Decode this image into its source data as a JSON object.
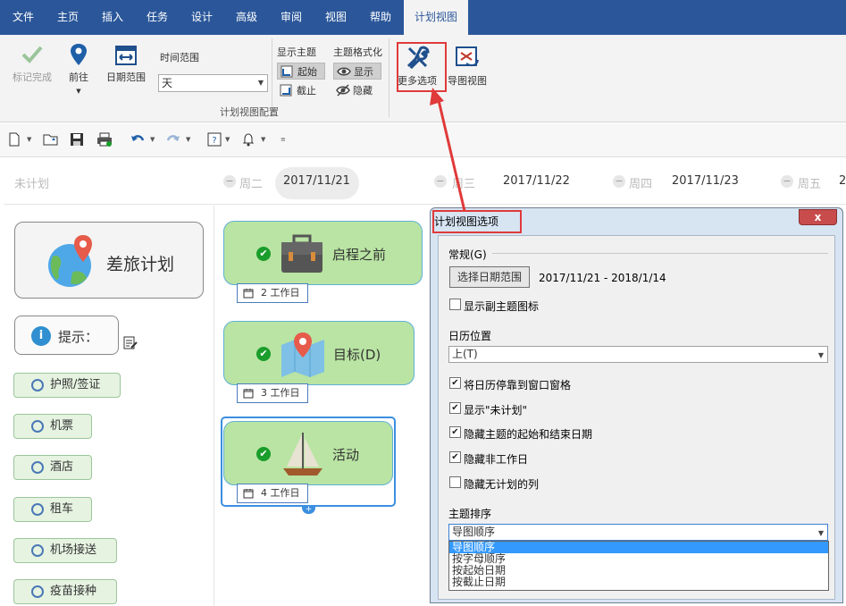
{
  "menu": {
    "tabs": [
      "文件",
      "主页",
      "插入",
      "任务",
      "设计",
      "高级",
      "审阅",
      "视图",
      "帮助",
      "计划视图"
    ],
    "active_tab": "计划视图"
  },
  "ribbon": {
    "mark_done": "标记完成",
    "go_to": "前往",
    "date_range": "日期范围",
    "time_range_label": "时间范围",
    "time_range_value": "天",
    "show_topic_label": "显示主题",
    "start_label": "起始",
    "end_label": "截止",
    "topic_format_label": "主题格式化",
    "show_label": "显示",
    "hide_label": "隐藏",
    "group_label": "计划视图配置",
    "more_options": "更多选项",
    "mindmap_view": "导图视图"
  },
  "timeline": {
    "unplanned": "未计划",
    "days": [
      {
        "weekday": "周二",
        "date": "2017/11/21"
      },
      {
        "weekday": "周三",
        "date": "2017/11/22"
      },
      {
        "weekday": "周四",
        "date": "2017/11/23"
      },
      {
        "weekday": "周五",
        "date": "2"
      }
    ]
  },
  "left": {
    "main_title": "差旅计划",
    "tip_label": "提示：",
    "items": [
      "护照/签证",
      "机票",
      "酒店",
      "租车",
      "机场接送",
      "疫苗接种"
    ]
  },
  "tasks": [
    {
      "name": "启程之前",
      "workdays": "2 工作日"
    },
    {
      "name": "目标(D)",
      "workdays": "3 工作日"
    },
    {
      "name": "活动",
      "workdays": "4 工作日"
    }
  ],
  "dialog": {
    "title": "计划视图选项",
    "close": "x",
    "general_label": "常规(G)",
    "select_date_range_btn": "选择日期范围",
    "date_range_value": "2017/11/21 - 2018/1/14",
    "show_sub_topic_icon": "显示副主题图标",
    "calendar_position_label": "日历位置",
    "calendar_position_value": "上(T)",
    "options": [
      {
        "label": "将日历停靠到窗口窗格",
        "checked": true
      },
      {
        "label": "显示\"未计划\"",
        "checked": true
      },
      {
        "label": "隐藏主题的起始和结束日期",
        "checked": true
      },
      {
        "label": "隐藏非工作日",
        "checked": true
      },
      {
        "label": "隐藏无计划的列",
        "checked": false
      }
    ],
    "sort_label": "主题排序",
    "sort_value": "导图顺序",
    "sort_options": [
      "导图顺序",
      "按字母顺序",
      "按起始日期",
      "按截止日期"
    ]
  },
  "colors": {
    "menu_bg": "#2b579a",
    "task_green": "#b9e4a3",
    "highlight_red": "#e03a3a",
    "check_green": "#1a9d2b"
  }
}
